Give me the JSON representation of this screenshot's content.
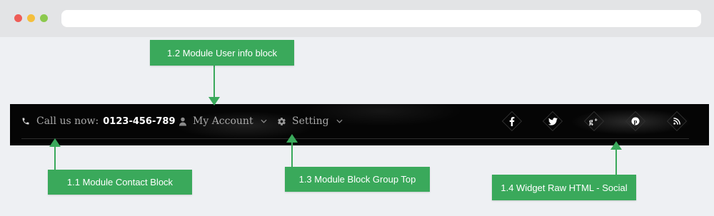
{
  "browser": {
    "buttons": [
      "close-dot",
      "minimize-dot",
      "maximize-dot"
    ]
  },
  "topbar": {
    "contact": {
      "label": "Call us now:",
      "phone": "0123-456-789",
      "icon": "phone-icon"
    },
    "account": {
      "label": "My Account",
      "icon": "user-icon"
    },
    "setting": {
      "label": "Setting",
      "icon": "gear-icon"
    },
    "social": [
      "facebook-icon",
      "twitter-icon",
      "google-plus-icon",
      "pinterest-icon",
      "rss-icon"
    ]
  },
  "callouts": {
    "contact_block": "1.1 Module Contact Block",
    "user_info_block": "1.2 Module User info block",
    "block_group_top": "1.3 Module Block Group Top",
    "widget_social": "1.4 Widget Raw HTML - Social"
  },
  "colors": {
    "callout": "#3aa95b",
    "topbar": "#050505",
    "page_bg": "#eef0f3"
  }
}
